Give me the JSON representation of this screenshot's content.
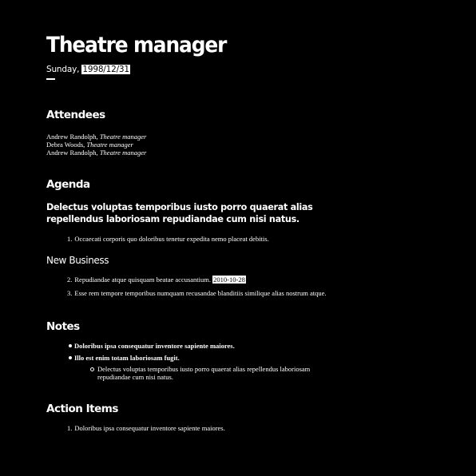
{
  "header": {
    "title": "Theatre manager",
    "day": "Sunday,",
    "date": "1998/12/31"
  },
  "attendees": {
    "heading": "Attendees",
    "people": [
      {
        "name": "Andrew Randolph,",
        "role": "Theatre manager"
      },
      {
        "name": "Debra Woods,",
        "role": "Theatre manager"
      },
      {
        "name": "Andrew Randolph,",
        "role": "Theatre manager"
      }
    ]
  },
  "agenda": {
    "heading": "Agenda",
    "lead": "Delectus voluptas temporibus iusto porro quaerat alias repellendus laboriosam repudiandae cum nisi natus.",
    "items": [
      {
        "num": "1.",
        "text": "Occaecati corporis quo doloribus tenetur expedita nemo placeat debitis."
      }
    ]
  },
  "new_business": {
    "heading": "New Business",
    "items": [
      {
        "num": "2.",
        "text": "Repudiandae atque quisquam beatae accusantium.",
        "date": "2010-10-28"
      },
      {
        "num": "3.",
        "text": "Esse rem tempore temporibus numquam recusandae blanditiis similique alias nostrum atque."
      }
    ]
  },
  "notes": {
    "heading": "Notes",
    "items": [
      {
        "text": "Doloribus ipsa consequatur inventore sapiente maiores."
      },
      {
        "text": "Illo est enim totam laboriosam fugit."
      }
    ],
    "sub_item": "Delectus voluptas temporibus iusto porro quaerat alias repellendus laboriosam repudiandae cum nisi natus."
  },
  "action_items": {
    "heading": "Action Items",
    "items": [
      {
        "num": "1.",
        "text": "Doloribus ipsa consequatur inventore sapiente maiores."
      }
    ]
  }
}
